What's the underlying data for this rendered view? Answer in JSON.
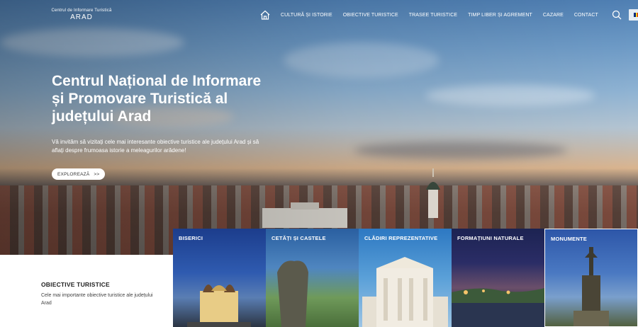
{
  "header": {
    "logo_line1": "Centrul de Informare Turistică",
    "logo_line2": "ARAD",
    "nav": [
      "CULTURĂ ȘI ISTORIE",
      "OBIECTIVE TURISTICE",
      "TRASEE TURISTICE",
      "TIMP LIBER ȘI AGREMENT",
      "CAZARE",
      "CONTACT"
    ],
    "language_flag_colors": [
      "#002b7f",
      "#fcd116",
      "#ce1126"
    ]
  },
  "hero": {
    "title": "Centrul Național de Informare și Promovare Turistică al județului Arad",
    "description": "Vă invităm să vizitați cele mai interesante obiective turistice ale județului Arad și să aflați despre frumoasa istorie a meleagurilor arădene!",
    "button": "EXPLOREAZĂ",
    "button_arrow": ">>"
  },
  "objectives": {
    "title": "OBIECTIVE TURISTICE",
    "description": "Cele mai importante obiective turistice ale județului Arad"
  },
  "categories": [
    {
      "label": "BISERICI"
    },
    {
      "label": "CETĂȚI ȘI CASTELE"
    },
    {
      "label": "CLĂDIRI REPREZENTATIVE"
    },
    {
      "label": "FORMAȚIUNI NATURALE"
    },
    {
      "label": "MONUMENTE"
    }
  ]
}
